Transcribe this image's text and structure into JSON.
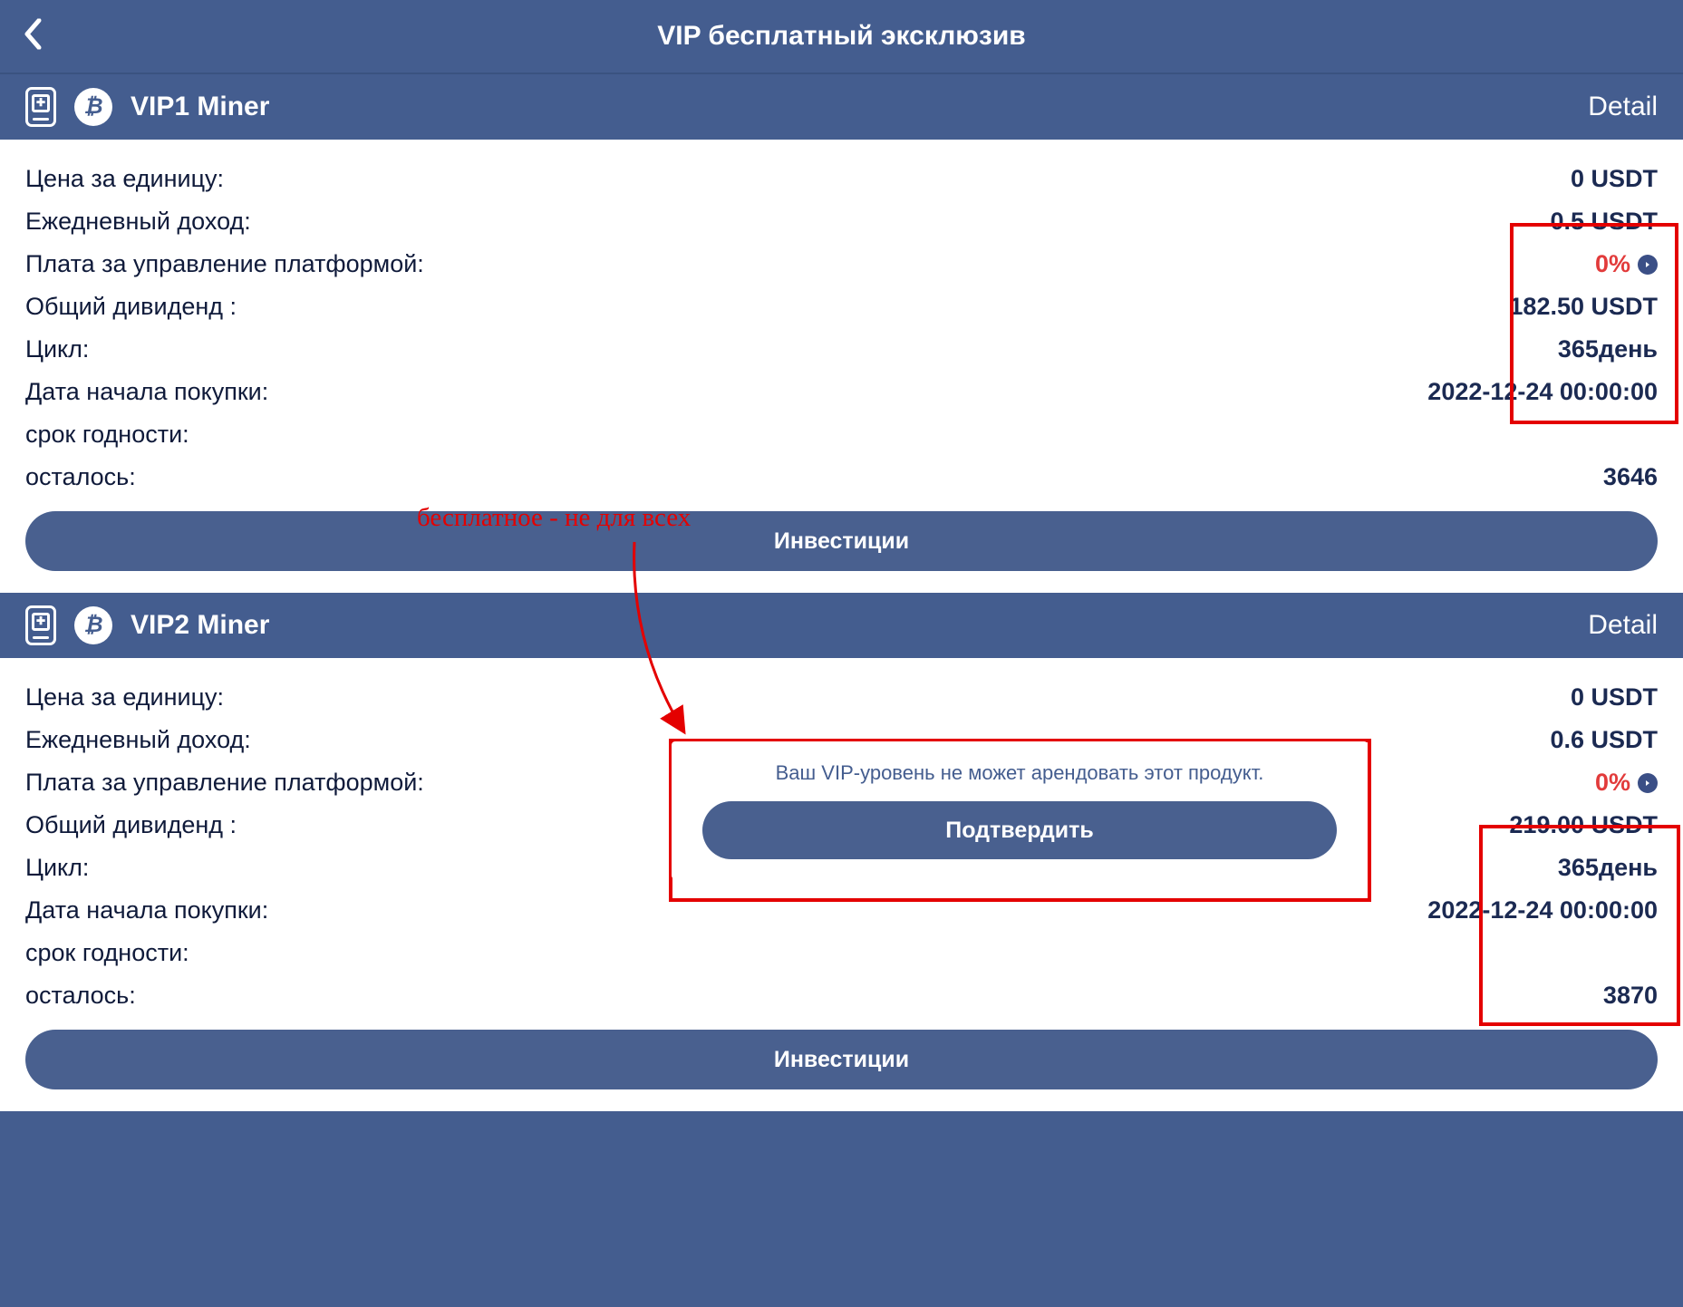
{
  "header": {
    "title": "VIP бесплатный эксклюзив"
  },
  "labels": {
    "price": "Цена за единицу:",
    "daily": "Ежедневный доход:",
    "fee": "Плата за управление платформой:",
    "dividend": "Общий дивиденд :",
    "cycle": "Цикл:",
    "start": "Дата начала покупки:",
    "expiry": "срок годности:",
    "remaining": "осталось:",
    "detail": "Detail",
    "invest": "Инвестиции"
  },
  "cards": [
    {
      "name": "VIP1 Miner",
      "vals": {
        "price": "0 USDT",
        "daily": "0.5 USDT",
        "fee": "0%",
        "dividend": "182.50 USDT",
        "cycle": "365день",
        "start": "2022-12-24 00:00:00",
        "expiry": "",
        "remaining": "3646"
      }
    },
    {
      "name": "VIP2 Miner",
      "vals": {
        "price": "0 USDT",
        "daily": "0.6 USDT",
        "fee": "0%",
        "dividend": "219.00 USDT",
        "cycle": "365день",
        "start": "2022-12-24 00:00:00",
        "expiry": "",
        "remaining": "3870"
      }
    }
  ],
  "modal": {
    "message": "Ваш VIP-уровень не может арендовать этот продукт.",
    "confirm": "Подтвердить"
  },
  "annotation": "бесплатное  - не для всех"
}
